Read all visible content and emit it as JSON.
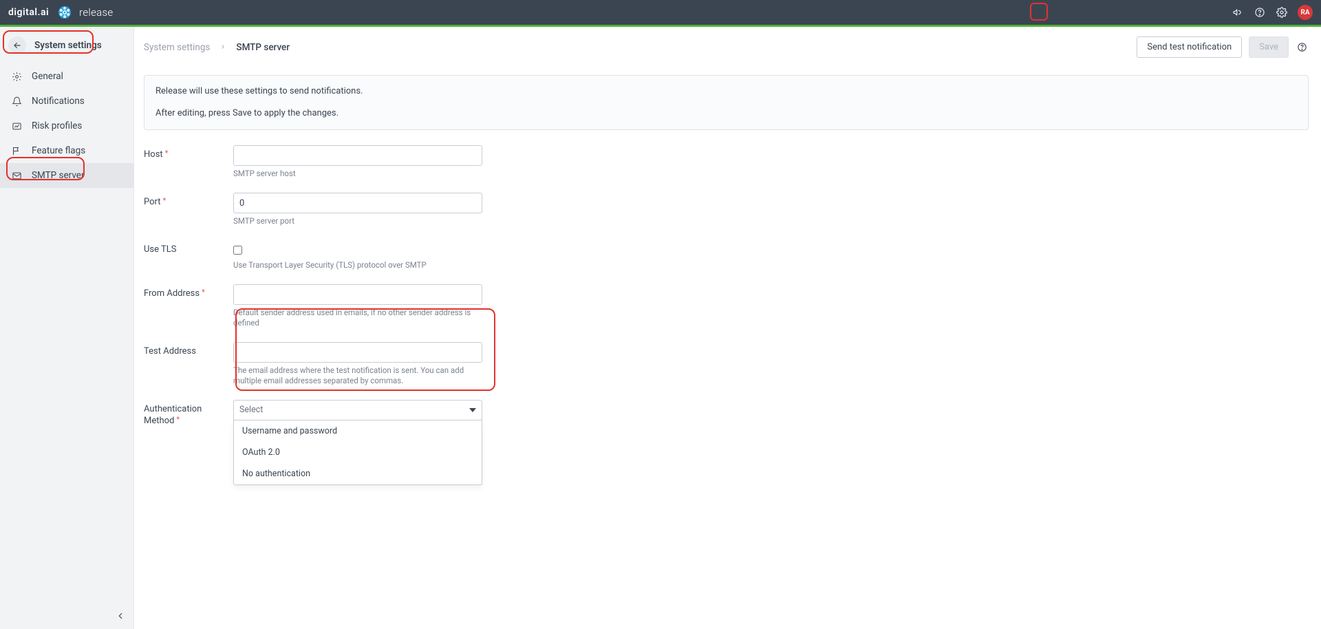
{
  "topbar": {
    "brand_company": "digital.ai",
    "brand_product": "release",
    "avatar_initials": "RA"
  },
  "sidebar": {
    "header": "System settings",
    "items": [
      {
        "label": "General"
      },
      {
        "label": "Notifications"
      },
      {
        "label": "Risk profiles"
      },
      {
        "label": "Feature flags"
      },
      {
        "label": "SMTP server"
      }
    ]
  },
  "breadcrumb": {
    "parent": "System settings",
    "current": "SMTP server"
  },
  "buttons": {
    "test": "Send test notification",
    "save": "Save"
  },
  "info": {
    "line1": "Release will use these settings to send notifications.",
    "line2": "After editing, press Save to apply the changes."
  },
  "form": {
    "host": {
      "label": "Host",
      "value": "",
      "help": "SMTP server host"
    },
    "port": {
      "label": "Port",
      "value": "0",
      "help": "SMTP server port"
    },
    "tls": {
      "label": "Use TLS",
      "help": "Use Transport Layer Security (TLS) protocol over SMTP"
    },
    "from": {
      "label": "From Address",
      "value": "",
      "help": "Default sender address used in emails, if no other sender address is defined"
    },
    "test": {
      "label": "Test Address",
      "value": "",
      "help": "The email address where the test notification is sent. You can add multiple email addresses separated by commas."
    },
    "auth": {
      "label": "Authentication Method",
      "selected": "Select",
      "options": [
        "Username and password",
        "OAuth 2.0",
        "No authentication"
      ]
    }
  }
}
